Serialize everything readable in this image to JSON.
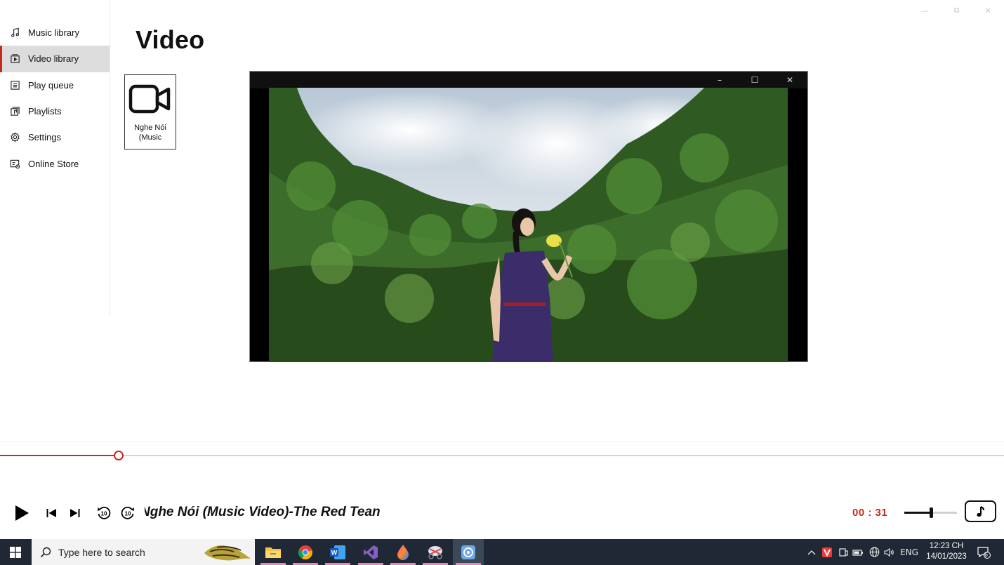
{
  "window": {
    "minimize_glyph": "—",
    "maximize_glyph": "⧉",
    "close_glyph": "✕"
  },
  "sidebar": {
    "items": [
      {
        "label": "Music library",
        "icon": "music-note-icon",
        "active": false
      },
      {
        "label": "Video library",
        "icon": "video-library-icon",
        "active": true
      },
      {
        "label": "Play queue",
        "icon": "list-icon",
        "active": false
      },
      {
        "label": "Playlists",
        "icon": "playlist-icon",
        "active": false
      },
      {
        "label": "Settings",
        "icon": "gear-icon",
        "active": false
      },
      {
        "label": "Online Store",
        "icon": "store-icon",
        "active": false
      }
    ]
  },
  "main": {
    "title": "Video",
    "video_tile": {
      "label": "Nghe Nói (Music",
      "icon": "video-camera-icon"
    }
  },
  "video_window": {
    "minimize_glyph": "–",
    "maximize_glyph": "☐",
    "close_glyph": "✕"
  },
  "player": {
    "progress": 0.118,
    "now_playing": "Nghe Nói (Music Video)-The Red Tean",
    "time": "00 : 31",
    "volume": 0.5,
    "accent_color": "#c42b1c"
  },
  "taskbar": {
    "search_placeholder": "Type here to search",
    "apps": [
      "file-explorer-icon",
      "chrome-icon",
      "word-icon",
      "visual-studio-icon",
      "paint-icon",
      "snipping-icon",
      "media-player-icon"
    ],
    "tray": {
      "language": "ENG",
      "time": "12:23 CH",
      "date": "14/01/2023",
      "notifications": "6"
    }
  }
}
